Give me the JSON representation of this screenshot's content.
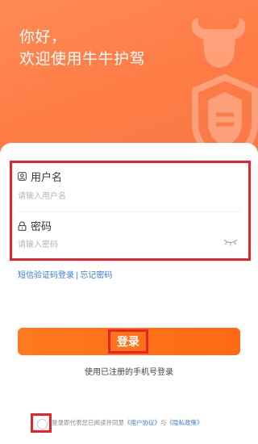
{
  "header": {
    "greeting_line1": "你好，",
    "greeting_line2": "欢迎使用牛牛护驾"
  },
  "form": {
    "username": {
      "label": "用户名",
      "placeholder": "请输入用户名",
      "icon": "user-icon"
    },
    "password": {
      "label": "密码",
      "placeholder": "请输入密码",
      "icon": "lock-icon",
      "toggle_icon": "eye-closed-icon"
    }
  },
  "links": {
    "sms_login": "短信验证码登录",
    "separator": "|",
    "forgot_password": "忘记密码"
  },
  "login_button": {
    "label": "登录"
  },
  "hint": "使用已注册的手机号登录",
  "agreement": {
    "prefix": "登录即代表您已阅读并同意",
    "user_agreement": "《用户协议》",
    "conjunction": "与",
    "privacy_policy": "《隐私政策》",
    "checked": false
  },
  "colors": {
    "brand_orange": "#ff7a1f",
    "header_orange": "#ff8450",
    "link_blue": "#3b7bd6",
    "highlight_red": "#e8222b"
  }
}
